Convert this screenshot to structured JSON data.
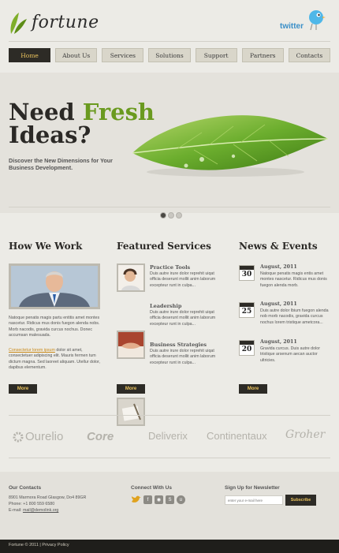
{
  "header": {
    "logo": "fortune",
    "twitter_label": "twitter"
  },
  "nav": [
    "Home",
    "About Us",
    "Services",
    "Solutions",
    "Support",
    "Partners",
    "Contacts"
  ],
  "hero": {
    "title_line1_a": "Need ",
    "title_line1_b": "Fresh",
    "title_line2": "Ideas?",
    "subtitle": "Discover the New Dimensions for Your Business Development.",
    "slide_count": 3,
    "active_slide": 1
  },
  "how": {
    "title": "How We Work",
    "p1": "Natoque penatis magis partu entitis amet montes nascetur. Ridicus mus donis fuegon alenda nobs. Morb nacodis, gravida curcus nochus. Donec accumsan malesuada.",
    "link": "Consectetur lorem ipsum",
    "p2": "dolor sit amet, consectetuer adipiscing elit. Mauris fermen tum dictum magna. Sed laoreet aliquam. Utellur dolor, dapibus elementum.",
    "more": "More"
  },
  "services": {
    "title": "Featured Services",
    "items": [
      {
        "title": "Practice Tools",
        "text": "Duis autre irure dolor reprehit uiqat officia deserunt mollit anim laborum excepteur  runt in culpa..."
      },
      {
        "title": "Leadership",
        "text": "Duis autre irure dolor reprehit uiqat officia deserunt mollit anim laborum excepteur  runt in culpa..."
      },
      {
        "title": "Business Strategies",
        "text": "Duis autre irure dolor reprehit uiqat officia deserunt mollit anim laborum excepteur  runt in culpa..."
      }
    ],
    "more": "More"
  },
  "news": {
    "title": "News & Events",
    "items": [
      {
        "day": "30",
        "date": "August, 2011",
        "text": "Natoque penatis magis entis amet montes nascetur. Ridicus mus donis fuegon alenda morb."
      },
      {
        "day": "25",
        "date": "August, 2011",
        "text": "Duis autre dolor lbium fuegon alenda nob morb nacodis, gravida curcus nochus lorem tristique ametcora..."
      },
      {
        "day": "20",
        "date": "August, 2011",
        "text": "Gravida curcus. Duis autre dolor tristique arsenum aecan auctor ultricies."
      }
    ],
    "more": "More"
  },
  "brands": [
    "Ourelio",
    "Core",
    "Deliverix",
    "Continentaux",
    "Groher"
  ],
  "footer": {
    "contacts_title": "Our Contacts",
    "address": "8901 Marmora Road Glasgow, Do4 89GR",
    "phone": "Phone: +1 800 559 6580",
    "email_label": "E-mail: ",
    "email": "mail@demolink.org",
    "connect_title": "Connect With Us",
    "newsletter_title": "Sign Up for Newsletter",
    "newsletter_placeholder": "enter your e-mail here",
    "subscribe": "Subscribe",
    "copyright": "Fortune © 2011 | Privacy Policy"
  },
  "colors": {
    "accent_green": "#6a9a1f",
    "dark": "#2d2b26",
    "gold": "#e9c25c"
  }
}
